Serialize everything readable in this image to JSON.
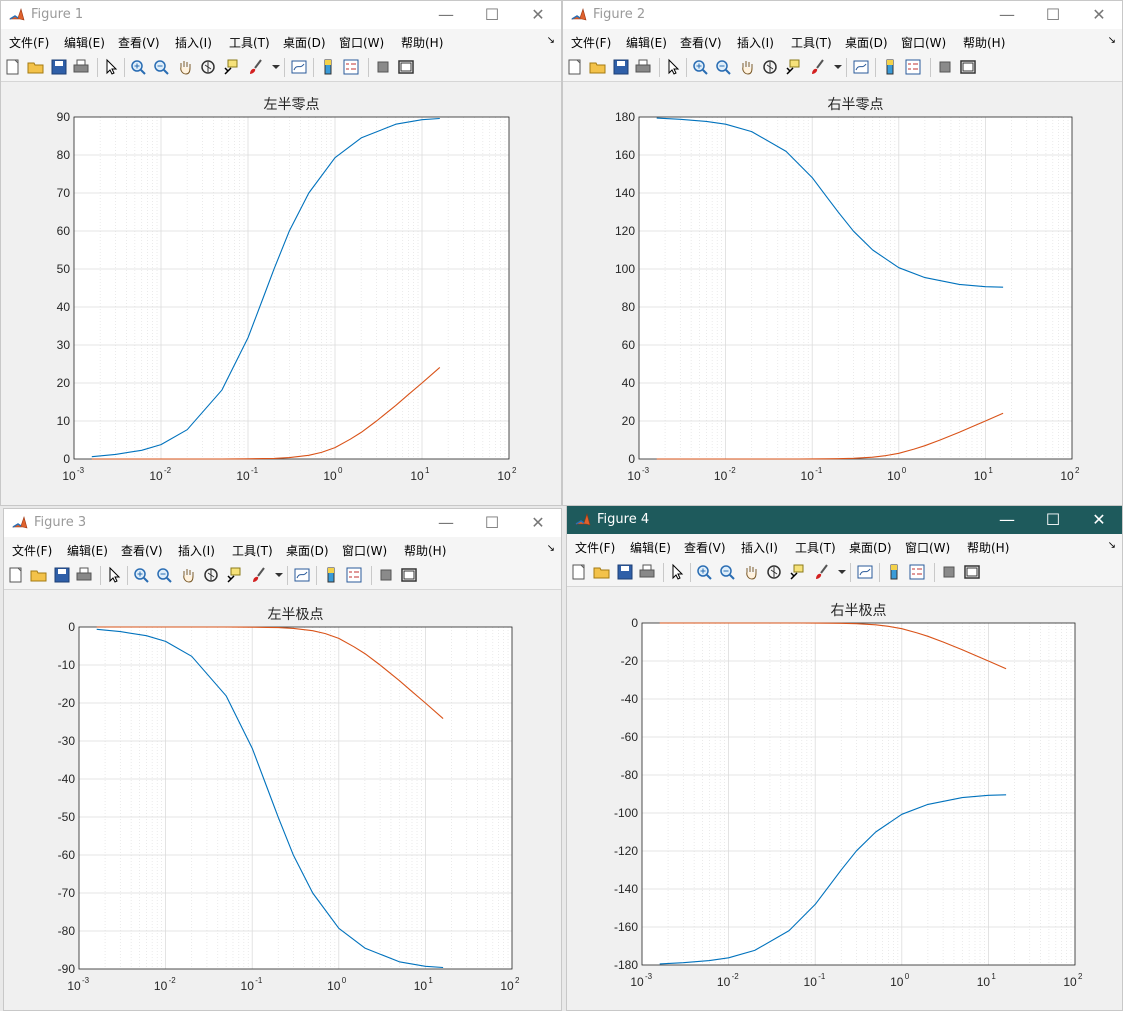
{
  "menu": [
    "文件(F)",
    "编辑(E)",
    "查看(V)",
    "插入(I)",
    "工具(T)",
    "桌面(D)",
    "窗口(W)",
    "帮助(H)"
  ],
  "menu_overflow": "↘",
  "window_controls": {
    "minimize": "—",
    "maximize": "☐",
    "close": "✕"
  },
  "toolbar_icons": [
    "new-figure-icon",
    "open-file-icon",
    "save-icon",
    "print-icon",
    "select-arrow-icon",
    "zoom-in-icon",
    "zoom-out-icon",
    "pan-hand-icon",
    "rotate-3d-icon",
    "data-cursor-icon",
    "brush-icon",
    "brush-dropdown-icon",
    "link-plot-icon",
    "colorbar-icon",
    "legend-icon",
    "hide-plot-tools-icon",
    "show-plot-tools-icon"
  ],
  "colors": {
    "series1": "#0072BD",
    "series2": "#D95319",
    "active_titlebar": "#1e5a5c",
    "grid": "#dcdcdc"
  },
  "figures": [
    {
      "title": "Figure 1",
      "active": false
    },
    {
      "title": "Figure 2",
      "active": false
    },
    {
      "title": "Figure 3",
      "active": false
    },
    {
      "title": "Figure 4",
      "active": true
    }
  ],
  "chart_data": [
    {
      "type": "line",
      "title": "左半零点",
      "xscale": "log",
      "xlim": [
        0.001,
        100
      ],
      "ylim": [
        0,
        90
      ],
      "xticks": [
        "10",
        "10",
        "10",
        "10",
        "10",
        "10"
      ],
      "xtick_exponents": [
        "-3",
        "-2",
        "-1",
        "0",
        "1",
        "2"
      ],
      "yticks": [
        "0",
        "10",
        "20",
        "30",
        "40",
        "50",
        "60",
        "70",
        "80",
        "90"
      ],
      "grid": true,
      "series": [
        {
          "x": [
            0.0016,
            0.003,
            0.006,
            0.01,
            0.02,
            0.05,
            0.1,
            0.15,
            0.2,
            0.3,
            0.5,
            1,
            2,
            5,
            10,
            16
          ],
          "y": [
            0.6,
            1.2,
            2.3,
            3.8,
            7.7,
            18.1,
            31.9,
            42.5,
            50.1,
            60.1,
            70.0,
            79.3,
            84.5,
            88.1,
            89.3,
            89.6
          ]
        },
        {
          "x": [
            0.0016,
            0.01,
            0.02,
            0.03,
            0.05,
            0.07,
            0.1,
            0.15,
            0.2,
            0.3,
            0.5,
            0.7,
            1,
            1.5,
            2,
            3,
            5,
            7,
            10,
            16
          ],
          "y": [
            0,
            0,
            0,
            0,
            0.01,
            0.02,
            0.04,
            0.1,
            0.17,
            0.37,
            0.97,
            1.74,
            3.0,
            5.2,
            7.0,
            10.0,
            14.1,
            17.0,
            20.0,
            24.1
          ]
        }
      ]
    },
    {
      "type": "line",
      "title": "右半零点",
      "xscale": "log",
      "xlim": [
        0.001,
        100
      ],
      "ylim": [
        0,
        180
      ],
      "xticks": [
        "10",
        "10",
        "10",
        "10",
        "10",
        "10"
      ],
      "xtick_exponents": [
        "-3",
        "-2",
        "-1",
        "0",
        "1",
        "2"
      ],
      "yticks": [
        "0",
        "20",
        "40",
        "60",
        "80",
        "100",
        "120",
        "140",
        "160",
        "180"
      ],
      "grid": true,
      "series": [
        {
          "x": [
            0.0016,
            0.003,
            0.006,
            0.01,
            0.02,
            0.05,
            0.1,
            0.15,
            0.2,
            0.3,
            0.5,
            1,
            2,
            5,
            10,
            16
          ],
          "y": [
            179.4,
            178.8,
            177.7,
            176.2,
            172.3,
            161.9,
            148.1,
            137.5,
            129.9,
            119.9,
            110.0,
            100.7,
            95.5,
            91.9,
            90.7,
            90.4
          ]
        },
        {
          "x": [
            0.0016,
            0.01,
            0.02,
            0.03,
            0.05,
            0.07,
            0.1,
            0.15,
            0.2,
            0.3,
            0.5,
            0.7,
            1,
            1.5,
            2,
            3,
            5,
            7,
            10,
            16
          ],
          "y": [
            0,
            0,
            0,
            0,
            0.01,
            0.02,
            0.04,
            0.1,
            0.17,
            0.37,
            0.97,
            1.74,
            3.0,
            5.2,
            7.0,
            10.0,
            14.1,
            17.0,
            20.0,
            24.1
          ]
        }
      ]
    },
    {
      "type": "line",
      "title": "左半极点",
      "xscale": "log",
      "xlim": [
        0.001,
        100
      ],
      "ylim": [
        -90,
        0
      ],
      "xticks": [
        "10",
        "10",
        "10",
        "10",
        "10",
        "10"
      ],
      "xtick_exponents": [
        "-3",
        "-2",
        "-1",
        "0",
        "1",
        "2"
      ],
      "yticks": [
        "-90",
        "-80",
        "-70",
        "-60",
        "-50",
        "-40",
        "-30",
        "-20",
        "-10",
        "0"
      ],
      "grid": true,
      "series": [
        {
          "x": [
            0.0016,
            0.003,
            0.006,
            0.01,
            0.02,
            0.05,
            0.1,
            0.15,
            0.2,
            0.3,
            0.5,
            1,
            2,
            5,
            10,
            16
          ],
          "y": [
            -0.6,
            -1.2,
            -2.3,
            -3.8,
            -7.7,
            -18.1,
            -31.9,
            -42.5,
            -50.1,
            -60.1,
            -70.0,
            -79.3,
            -84.5,
            -88.1,
            -89.3,
            -89.6
          ]
        },
        {
          "x": [
            0.0016,
            0.01,
            0.02,
            0.03,
            0.05,
            0.07,
            0.1,
            0.15,
            0.2,
            0.3,
            0.5,
            0.7,
            1,
            1.5,
            2,
            3,
            5,
            7,
            10,
            16
          ],
          "y": [
            0,
            0,
            0,
            0,
            -0.01,
            -0.02,
            -0.04,
            -0.1,
            -0.17,
            -0.37,
            -0.97,
            -1.74,
            -3.0,
            -5.2,
            -7.0,
            -10.0,
            -14.1,
            -17.0,
            -20.0,
            -24.1
          ]
        }
      ]
    },
    {
      "type": "line",
      "title": "右半极点",
      "xscale": "log",
      "xlim": [
        0.001,
        100
      ],
      "ylim": [
        -180,
        0
      ],
      "xticks": [
        "10",
        "10",
        "10",
        "10",
        "10",
        "10"
      ],
      "xtick_exponents": [
        "-3",
        "-2",
        "-1",
        "0",
        "1",
        "2"
      ],
      "yticks": [
        "-180",
        "-160",
        "-140",
        "-120",
        "-100",
        "-80",
        "-60",
        "-40",
        "-20",
        "0"
      ],
      "grid": true,
      "series": [
        {
          "x": [
            0.0016,
            0.003,
            0.006,
            0.01,
            0.02,
            0.05,
            0.1,
            0.15,
            0.2,
            0.3,
            0.5,
            1,
            2,
            5,
            10,
            16
          ],
          "y": [
            -179.4,
            -178.8,
            -177.7,
            -176.2,
            -172.3,
            -161.9,
            -148.1,
            -137.5,
            -129.9,
            -119.9,
            -110.0,
            -100.7,
            -95.5,
            -91.9,
            -90.7,
            -90.4
          ]
        },
        {
          "x": [
            0.0016,
            0.01,
            0.02,
            0.03,
            0.05,
            0.07,
            0.1,
            0.15,
            0.2,
            0.3,
            0.5,
            0.7,
            1,
            1.5,
            2,
            3,
            5,
            7,
            10,
            16
          ],
          "y": [
            0,
            0,
            0,
            0,
            -0.01,
            -0.02,
            -0.04,
            -0.1,
            -0.17,
            -0.37,
            -0.97,
            -1.74,
            -3.0,
            -5.2,
            -7.0,
            -10.0,
            -14.1,
            -17.0,
            -20.0,
            -24.1
          ]
        }
      ]
    }
  ]
}
